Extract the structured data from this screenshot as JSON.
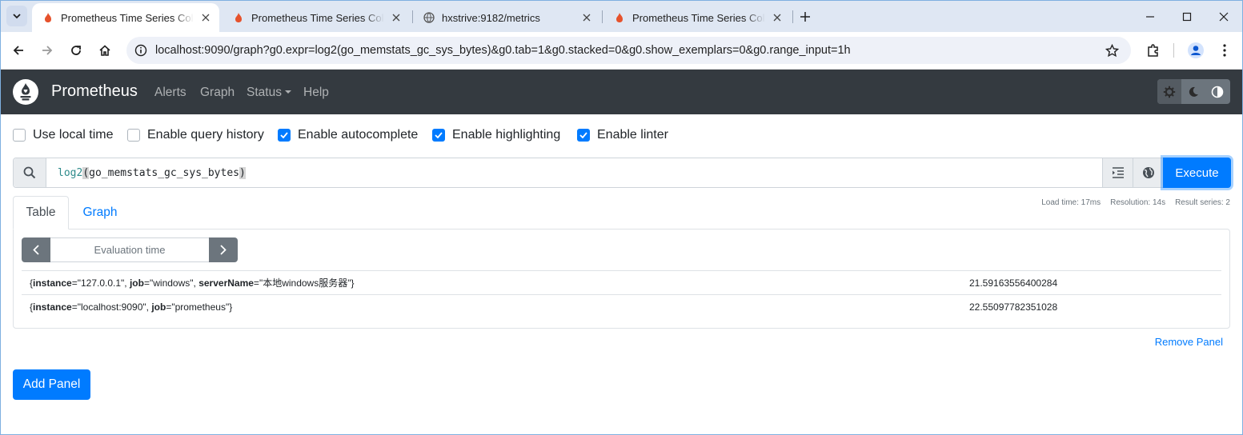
{
  "browser": {
    "tabs": [
      {
        "title": "Prometheus Time Series Collection",
        "active": true
      },
      {
        "title": "Prometheus Time Series Collection",
        "active": false
      },
      {
        "title": "hxstrive:9182/metrics",
        "active": false
      },
      {
        "title": "Prometheus Time Series Collection",
        "active": false
      }
    ],
    "url": "localhost:9090/graph?g0.expr=log2(go_memstats_gc_sys_bytes)&g0.tab=1&g0.stacked=0&g0.show_exemplars=0&g0.range_input=1h"
  },
  "navbar": {
    "brand": "Prometheus",
    "links": {
      "alerts": "Alerts",
      "graph": "Graph",
      "status": "Status",
      "help": "Help"
    }
  },
  "options": {
    "local_time": {
      "label": "Use local time",
      "checked": false
    },
    "query_history": {
      "label": "Enable query history",
      "checked": false
    },
    "autocomplete": {
      "label": "Enable autocomplete",
      "checked": true
    },
    "highlighting": {
      "label": "Enable highlighting",
      "checked": true
    },
    "linter": {
      "label": "Enable linter",
      "checked": true
    }
  },
  "expression": {
    "fn": "log2",
    "open": "(",
    "arg": "go_memstats_gc_sys_bytes",
    "close": ")",
    "execute_label": "Execute"
  },
  "stats": {
    "load_time": "Load time: 17ms",
    "resolution": "Resolution: 14s",
    "result_series": "Result series: 2"
  },
  "panel_tabs": {
    "table": "Table",
    "graph": "Graph"
  },
  "eval_time_placeholder": "Evaluation time",
  "results": [
    {
      "labels": [
        {
          "key": "instance",
          "value": "\"127.0.0.1\""
        },
        {
          "key": "job",
          "value": "\"windows\""
        },
        {
          "key": "serverName",
          "value": "\"本地windows服务器\""
        }
      ],
      "value": "21.59163556400284"
    },
    {
      "labels": [
        {
          "key": "instance",
          "value": "\"localhost:9090\""
        },
        {
          "key": "job",
          "value": "\"prometheus\""
        }
      ],
      "value": "22.55097782351028"
    }
  ],
  "remove_panel": "Remove Panel",
  "add_panel": "Add Panel",
  "colors": {
    "primary": "#007bff",
    "navbar": "#343a40",
    "secondary": "#6c757d"
  }
}
